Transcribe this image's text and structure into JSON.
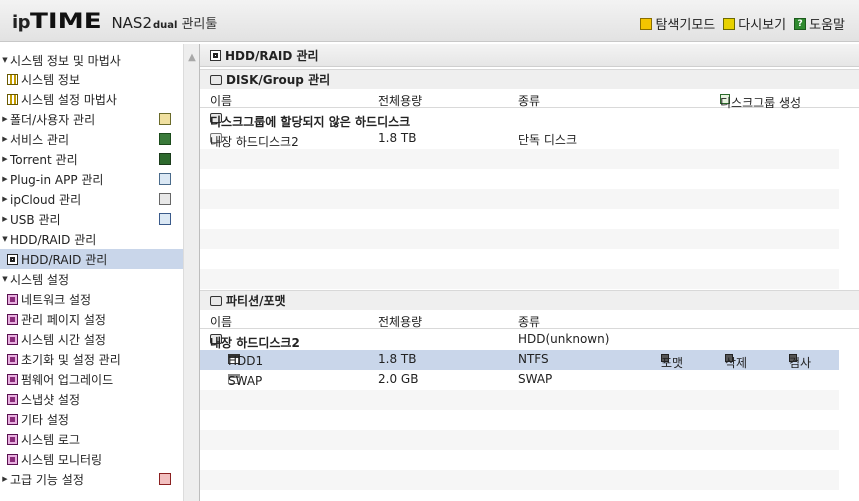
{
  "header": {
    "logo_ip": "ip",
    "logo_time": "TIME",
    "logo_nas": "NAS2",
    "logo_dual": "dual",
    "logo_tool": "관리툴",
    "links": [
      {
        "label": "탐색기모드",
        "icon": "folder-icon"
      },
      {
        "label": "다시보기",
        "icon": "reload-icon"
      },
      {
        "label": "도움말",
        "icon": "help-icon"
      }
    ]
  },
  "sidebar": {
    "items": [
      {
        "label": "시스템 정보 및 마법사",
        "level": 0
      },
      {
        "label": "시스템 정보",
        "level": 1,
        "icon": "info-icon"
      },
      {
        "label": "시스템 설정 마법사",
        "level": 1,
        "icon": "info-icon"
      },
      {
        "label": "폴더/사용자 관리",
        "level": 0
      },
      {
        "label": "서비스 관리",
        "level": 0
      },
      {
        "label": "Torrent 관리",
        "level": 0
      },
      {
        "label": "Plug-in APP 관리",
        "level": 0
      },
      {
        "label": "ipCloud 관리",
        "level": 0
      },
      {
        "label": "USB 관리",
        "level": 0
      },
      {
        "label": "HDD/RAID 관리",
        "level": 0
      },
      {
        "label": "HDD/RAID 관리",
        "level": 1,
        "icon": "hdd-icon",
        "selected": true
      },
      {
        "label": "시스템 설정",
        "level": 0
      },
      {
        "label": "네트워크 설정",
        "level": 1,
        "icon": "gear-icon"
      },
      {
        "label": "관리 페이지 설정",
        "level": 1,
        "icon": "gear-icon"
      },
      {
        "label": "시스템 시간 설정",
        "level": 1,
        "icon": "gear-icon"
      },
      {
        "label": "초기화 및 설정 관리",
        "level": 1,
        "icon": "gear-icon"
      },
      {
        "label": "펌웨어 업그레이드",
        "level": 1,
        "icon": "gear-icon"
      },
      {
        "label": "스냅샷 설정",
        "level": 1,
        "icon": "gear-icon"
      },
      {
        "label": "기타 설정",
        "level": 1,
        "icon": "gear-icon"
      },
      {
        "label": "시스템 로그",
        "level": 1,
        "icon": "gear-icon"
      },
      {
        "label": "시스템 모니터링",
        "level": 1,
        "icon": "gear-icon"
      },
      {
        "label": "고급 기능 설정",
        "level": 0
      }
    ]
  },
  "main": {
    "panel_title": "HDD/RAID 관리",
    "disk_group": {
      "title": "DISK/Group 관리",
      "columns": [
        "이름",
        "전체용량",
        "종류"
      ],
      "create_label": "디스크그룹 생성",
      "group_row": "디스크그룹에 할당되지 않은 하드디스크",
      "rows": [
        {
          "name": "내장 하드디스크2",
          "capacity": "1.8 TB",
          "type": "단독 디스크"
        }
      ]
    },
    "partition": {
      "title": "파티션/포맷",
      "columns": [
        "이름",
        "전체용량",
        "종류"
      ],
      "group_row": {
        "name": "내장 하드디스크2",
        "type": "HDD(unknown)"
      },
      "rows": [
        {
          "name": "HDD1",
          "capacity": "1.8 TB",
          "type": "NTFS",
          "actions": [
            "포맷",
            "삭제",
            "검사"
          ]
        },
        {
          "name": "SWAP",
          "capacity": "2.0 GB",
          "type": "SWAP"
        }
      ]
    }
  }
}
